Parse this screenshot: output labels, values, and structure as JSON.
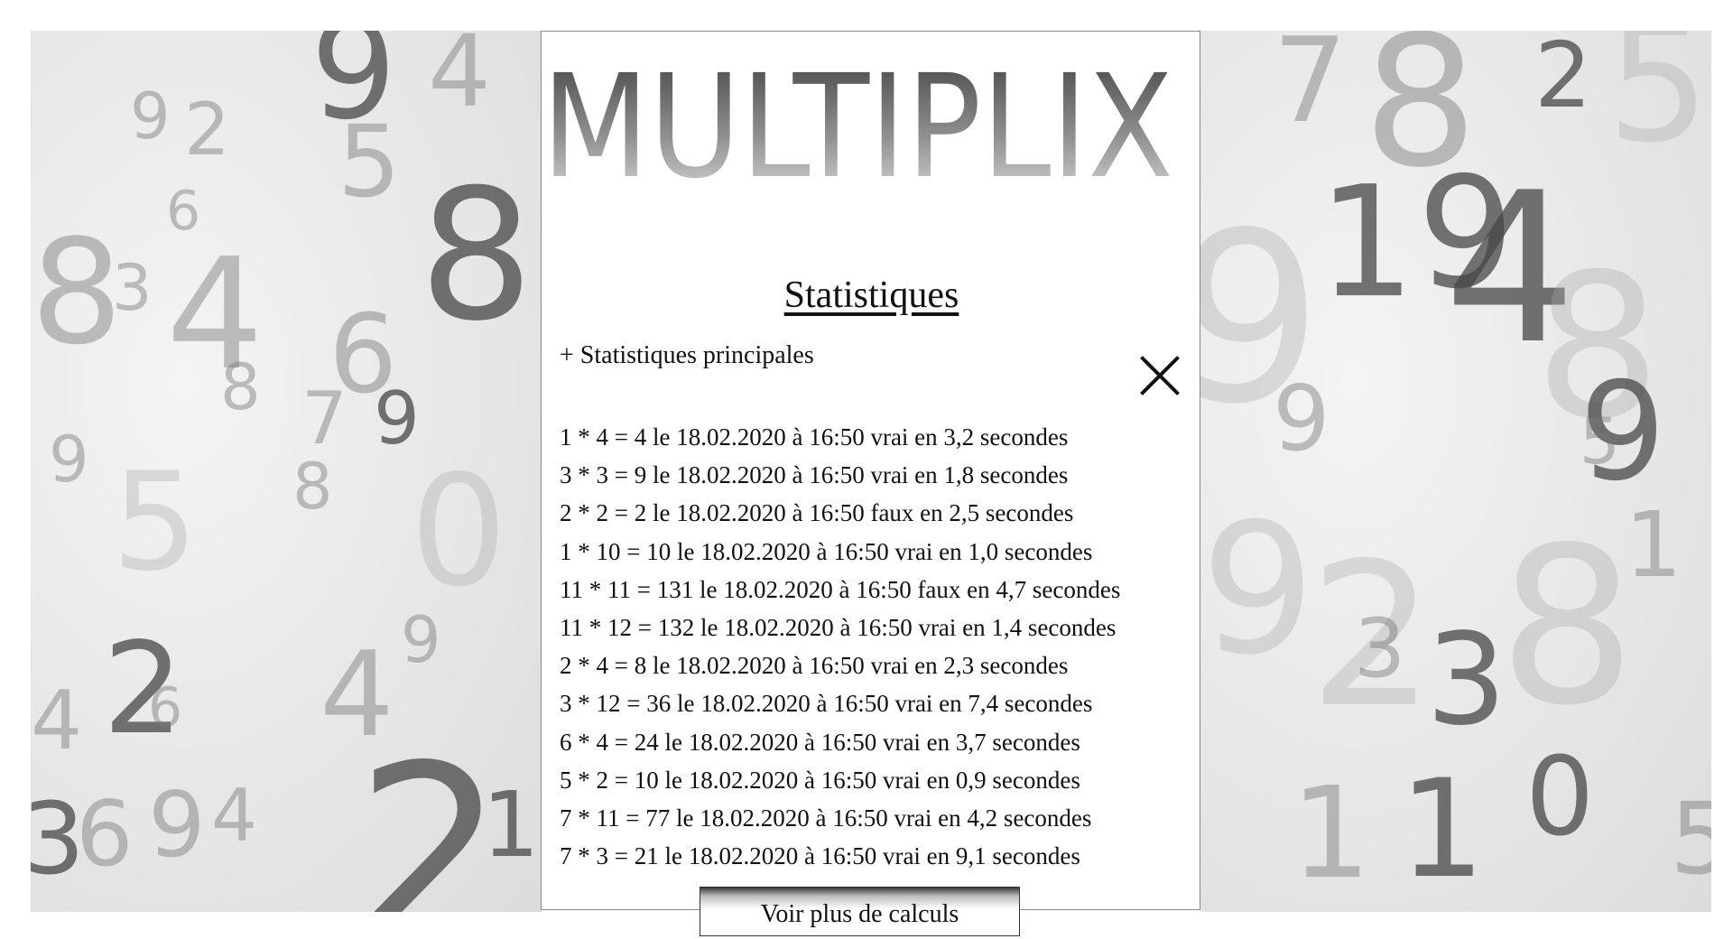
{
  "logo": {
    "text": "MULTIPLIX"
  },
  "page_title": "Statistiques",
  "main_stats_toggle": "+ Statistiques principales",
  "calculations": [
    "1 * 4 = 4 le 18.02.2020 à 16:50 vrai en 3,2 secondes",
    "3 * 3 = 9 le 18.02.2020 à 16:50 vrai en 1,8 secondes",
    "2 * 2 = 2 le 18.02.2020 à 16:50 faux en 2,5 secondes",
    "1 * 10 = 10 le 18.02.2020 à 16:50 vrai en 1,0 secondes",
    "11 * 11 = 131 le 18.02.2020 à 16:50 faux en 4,7 secondes",
    "11 * 12 = 132 le 18.02.2020 à 16:50 vrai en 1,4 secondes",
    "2 * 4 = 8 le 18.02.2020 à 16:50 vrai en 2,3 secondes",
    "3 * 12 = 36 le 18.02.2020 à 16:50 vrai en 7,4 secondes",
    "6 * 4 = 24 le 18.02.2020 à 16:50 vrai en 3,7 secondes",
    "5 * 2 = 10 le 18.02.2020 à 16:50 vrai en 0,9 secondes",
    "7 * 11 = 77 le 18.02.2020 à 16:50 vrai en 4,2 secondes",
    "7 * 3 = 21 le 18.02.2020 à 16:50 vrai en 9,1 secondes"
  ],
  "more_button": "Voir plus de calculs",
  "icons": {
    "close": "close-icon"
  },
  "colors": {
    "text": "#111111",
    "panel_border": "#8a8a8a",
    "background_paper": "#e6e6e6"
  }
}
